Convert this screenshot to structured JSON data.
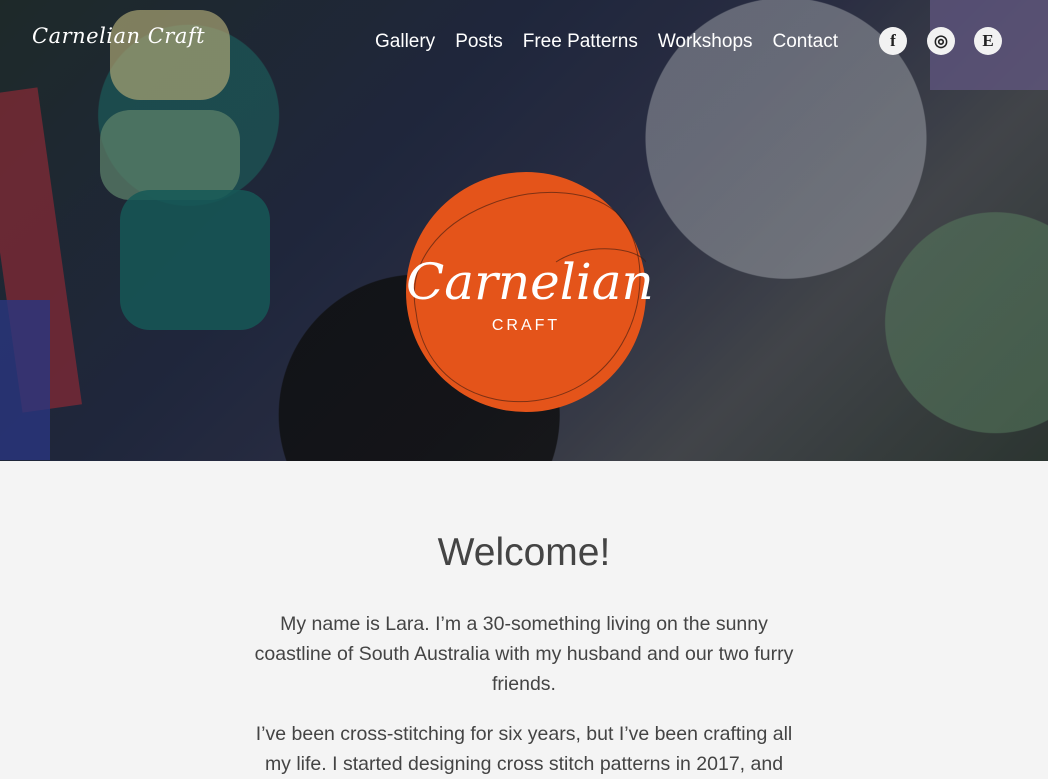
{
  "header": {
    "logo_text": "Carnelian Craft",
    "nav": [
      {
        "label": "Gallery"
      },
      {
        "label": "Posts"
      },
      {
        "label": "Free Patterns"
      },
      {
        "label": "Workshops"
      },
      {
        "label": "Contact"
      }
    ],
    "social": [
      {
        "icon": "facebook-icon",
        "glyph": "f"
      },
      {
        "icon": "instagram-icon",
        "glyph": "◎"
      },
      {
        "icon": "etsy-icon",
        "glyph": "E"
      }
    ]
  },
  "hero": {
    "badge_title": "Carnelian",
    "badge_subtitle": "CRAFT"
  },
  "main": {
    "heading": "Welcome!",
    "paragraphs": [
      "My name is Lara. I’m a 30-something living on the sunny coastline of South Australia with my husband and our two furry friends.",
      "I’ve been cross-stitching for six years, but I’ve been crafting all my life. I started designing cross stitch patterns in 2017, and"
    ]
  },
  "colors": {
    "accent": "#e4541a",
    "text": "#444444",
    "background": "#f4f4f4"
  }
}
